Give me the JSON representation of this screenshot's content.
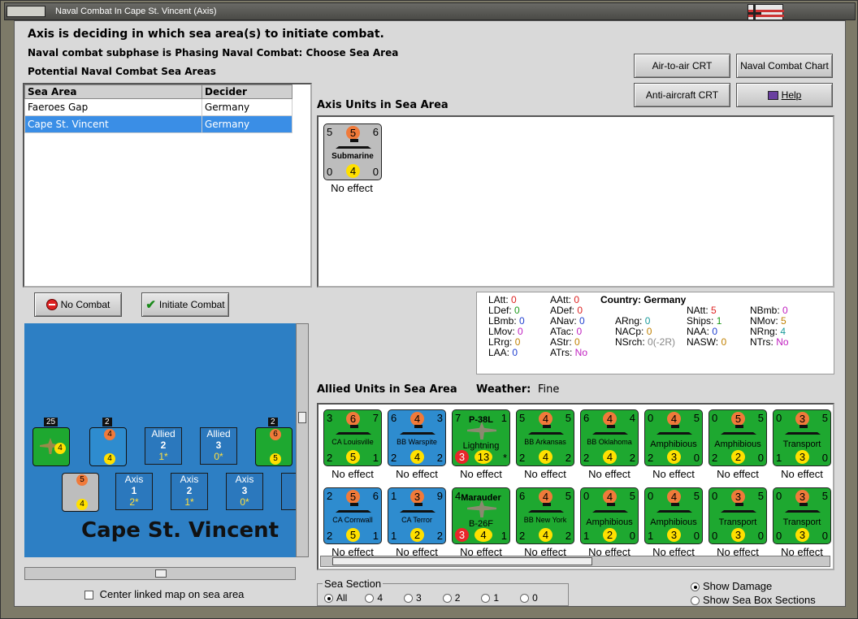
{
  "window": {
    "title": "Naval Combat In Cape St. Vincent (Axis)"
  },
  "header": {
    "line1": "Axis is deciding in which sea area(s) to initiate combat.",
    "line2": "Naval combat subphase is Phasing Naval Combat: Choose Sea Area",
    "line3": "Potential Naval Combat Sea Areas"
  },
  "buttons": {
    "air_to_air": "Air-to-air CRT",
    "naval_chart": "Naval Combat Chart",
    "anti_aircraft": "Anti-aircraft CRT",
    "help": "Help",
    "no_combat": "No Combat",
    "initiate_combat": "Initiate Combat"
  },
  "sea_table": {
    "headers": [
      "Sea Area",
      "Decider"
    ],
    "rows": [
      {
        "area": "Faeroes Gap",
        "decider": "Germany"
      },
      {
        "area": "Cape St. Vincent",
        "decider": "Germany"
      }
    ]
  },
  "axis_units": {
    "title": "Axis Units in Sea Area",
    "unit": {
      "tl": "5",
      "tc": "5",
      "tr": "6",
      "name": "Submarine",
      "bl": "0",
      "bc": "4",
      "br": "0",
      "effect": "No effect"
    }
  },
  "stats": {
    "country_label": "Country:",
    "country": "Germany",
    "LAtt": "0",
    "LDef": "0",
    "LBmb": "0",
    "LMov": "0",
    "LRrg": "0",
    "LAA": "0",
    "AAtt": "0",
    "ADef": "0",
    "ANav": "0",
    "ATac": "0",
    "AStr": "0",
    "ATrs": "No",
    "ARng": "0",
    "NACp": "0",
    "NSrch": "0(-2R)",
    "NAtt": "5",
    "Ships": "1",
    "NAA": "0",
    "NASW": "0",
    "NBmb": "0",
    "NMov": "5",
    "NRng": "4",
    "NTrs": "No"
  },
  "allied": {
    "title": "Allied Units in Sea Area",
    "weather_label": "Weather:",
    "weather": "Fine",
    "row1": [
      {
        "color": "green",
        "tl": "3",
        "tc": "6",
        "tr": "7",
        "name": "CA Louisville",
        "bl": "2",
        "bc": "5",
        "br": "1",
        "effect": "No effect"
      },
      {
        "color": "blue",
        "tl": "6",
        "tc": "4",
        "tr": "3",
        "name": "BB Warspite",
        "bl": "2",
        "bc": "4",
        "br": "2",
        "effect": "No effect"
      },
      {
        "color": "green",
        "tl": "7",
        "tc": "",
        "tr": "1",
        "name": "P-38L",
        "name2": "Lightning",
        "bl": "3",
        "bc": "13",
        "br": "*",
        "effect": "No effect",
        "plane": true
      },
      {
        "color": "green",
        "tl": "5",
        "tc": "4",
        "tr": "5",
        "name": "BB Arkansas",
        "bl": "2",
        "bc": "4",
        "br": "2",
        "effect": "No effect"
      },
      {
        "color": "green",
        "tl": "6",
        "tc": "4",
        "tr": "4",
        "name": "BB Oklahoma",
        "bl": "2",
        "bc": "4",
        "br": "2",
        "effect": "No effect"
      },
      {
        "color": "green",
        "tl": "0",
        "tc": "4",
        "tr": "5",
        "name": "Amphibious",
        "bl": "2",
        "bc": "3",
        "br": "0",
        "effect": "No effect",
        "big": true
      },
      {
        "color": "green",
        "tl": "0",
        "tc": "5",
        "tr": "5",
        "name": "Amphibious",
        "bl": "2",
        "bc": "2",
        "br": "0",
        "effect": "No effect",
        "big": true
      },
      {
        "color": "green",
        "tl": "0",
        "tc": "3",
        "tr": "5",
        "name": "Transport",
        "bl": "1",
        "bc": "3",
        "br": "0",
        "effect": "No effect",
        "big": true
      }
    ],
    "row2": [
      {
        "color": "blue",
        "tl": "2",
        "tc": "5",
        "tr": "6",
        "name": "CA Cornwall",
        "bl": "2",
        "bc": "5",
        "br": "1",
        "effect": "No effect"
      },
      {
        "color": "blue",
        "tl": "1",
        "tc": "3",
        "tr": "9",
        "name": "CA Terror",
        "bl": "1",
        "bc": "2",
        "br": "2",
        "effect": "No effect"
      },
      {
        "color": "green",
        "tl": "4",
        "tc": "",
        "tr": "",
        "name": "Marauder",
        "name2": "B-26F",
        "bl": "3",
        "bc": "4",
        "br": "1",
        "effect": "No effect",
        "plane": true
      },
      {
        "color": "green",
        "tl": "6",
        "tc": "4",
        "tr": "5",
        "name": "BB New York",
        "bl": "2",
        "bc": "4",
        "br": "2",
        "effect": "No effect"
      },
      {
        "color": "green",
        "tl": "0",
        "tc": "4",
        "tr": "5",
        "name": "Amphibious",
        "bl": "1",
        "bc": "2",
        "br": "0",
        "effect": "No effect",
        "big": true
      },
      {
        "color": "green",
        "tl": "0",
        "tc": "4",
        "tr": "5",
        "name": "Amphibious",
        "bl": "1",
        "bc": "3",
        "br": "0",
        "effect": "No effect",
        "big": true
      },
      {
        "color": "green",
        "tl": "0",
        "tc": "3",
        "tr": "5",
        "name": "Transport",
        "bl": "0",
        "bc": "3",
        "br": "0",
        "effect": "No effect",
        "big": true
      },
      {
        "color": "green",
        "tl": "0",
        "tc": "3",
        "tr": "5",
        "name": "Transport",
        "bl": "0",
        "bc": "3",
        "br": "0",
        "effect": "No effect",
        "big": true
      }
    ]
  },
  "map": {
    "sea_name": "Cape St. Vincent",
    "allied_boxes": [
      {
        "label": "Allied",
        "num": "2",
        "sub": "1*"
      },
      {
        "label": "Allied",
        "num": "3",
        "sub": "0*"
      }
    ],
    "axis_boxes": [
      {
        "label": "Axis",
        "num": "1",
        "sub": "2*"
      },
      {
        "label": "Axis",
        "num": "2",
        "sub": "1*"
      },
      {
        "label": "Axis",
        "num": "3",
        "sub": "0*"
      },
      {
        "label": "A",
        "num": "",
        "sub": ""
      }
    ],
    "counts": [
      "25",
      "2",
      "2"
    ],
    "center_label": "Center linked map on sea area"
  },
  "sea_section": {
    "label": "Sea Section",
    "options": [
      "All",
      "4",
      "3",
      "2",
      "1",
      "0"
    ],
    "selected": "All"
  },
  "show": {
    "damage": "Show Damage",
    "boxes": "Show Sea Box Sections"
  }
}
